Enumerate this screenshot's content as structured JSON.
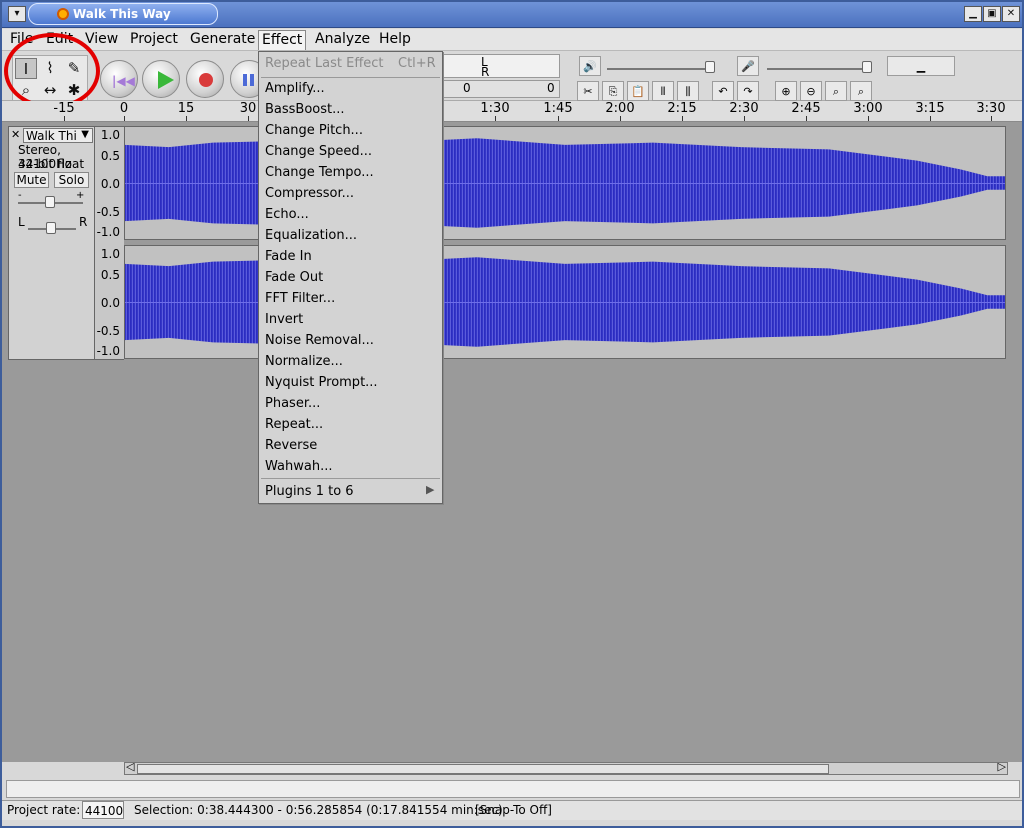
{
  "window": {
    "title": "Walk This Way"
  },
  "menus": [
    "File",
    "Edit",
    "View",
    "Project",
    "Generate",
    "Effect",
    "Analyze",
    "Help"
  ],
  "meter": {
    "left_marker": "L",
    "right_marker": "R",
    "values": [
      "0",
      "0"
    ]
  },
  "ruler": {
    "labels": [
      "-15",
      "0",
      "15",
      "30",
      "1:30",
      "1:45",
      "2:00",
      "2:15",
      "2:30",
      "2:45",
      "3:00",
      "3:15",
      "3:30"
    ]
  },
  "track": {
    "name": "Walk Thi",
    "format": "Stereo, 44100Hz",
    "bitdepth": "32-bit float",
    "mute": "Mute",
    "solo": "Solo",
    "pan_left": "L",
    "pan_right": "R",
    "minus": "-",
    "plus": "+",
    "scale": [
      "1.0",
      "0.5",
      "0.0",
      "-0.5",
      "-1.0"
    ]
  },
  "effect_menu": {
    "repeat_last": "Repeat Last Effect",
    "repeat_shortcut": "Ctl+R",
    "items": [
      "Amplify...",
      "BassBoost...",
      "Change Pitch...",
      "Change Speed...",
      "Change Tempo...",
      "Compressor...",
      "Echo...",
      "Equalization...",
      "Fade In",
      "Fade Out",
      "FFT Filter...",
      "Invert",
      "Noise Removal...",
      "Normalize...",
      "Nyquist Prompt...",
      "Phaser...",
      "Repeat...",
      "Reverse",
      "Wahwah..."
    ],
    "plugins": "Plugins 1 to 6"
  },
  "status": {
    "project_rate_label": "Project rate:",
    "project_rate": "44100",
    "selection": "Selection: 0:38.444300 - 0:56.285854 (0:17.841554 min:sec)",
    "snap": "[Snap-To Off]"
  }
}
